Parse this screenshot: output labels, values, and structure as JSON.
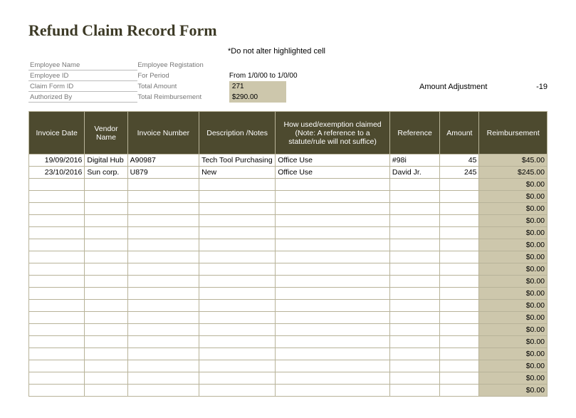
{
  "title": "Refund Claim Record Form",
  "note": "*Do not alter highlighted cell",
  "meta": {
    "labels1": [
      "Employee Name",
      "Employee ID",
      "Claim Form ID",
      "Authorized By"
    ],
    "labels2": [
      "Employee Registation",
      "For Period",
      "Total Amount",
      "Total Reimbursement"
    ],
    "values3": [
      "",
      "From 1/0/00 to 1/0/00",
      "271",
      "$290.00"
    ]
  },
  "adjustment": {
    "label": "Amount Adjustment",
    "value": "-19"
  },
  "headers": [
    "Invoice Date",
    "Vendor Name",
    "Invoice Number",
    "Description /Notes",
    "How used/exemption claimed (Note:  A reference to a statute/rule will not suffice)",
    "Reference",
    "Amount",
    "Reimbursement"
  ],
  "rows": [
    {
      "invdate": "19/09/2016",
      "vendor": "Digital Hub",
      "invnum": "A90987",
      "desc": "Tech Tool Purchasing",
      "how": "Office Use",
      "ref": "#98i",
      "amt": "45",
      "reimb": "$45.00"
    },
    {
      "invdate": "23/10/2016",
      "vendor": "Sun corp.",
      "invnum": "U879",
      "desc": "New",
      "how": "Office Use",
      "ref": "David Jr.",
      "amt": "245",
      "reimb": "$245.00"
    },
    {
      "invdate": "",
      "vendor": "",
      "invnum": "",
      "desc": "",
      "how": "",
      "ref": "",
      "amt": "",
      "reimb": "$0.00"
    },
    {
      "invdate": "",
      "vendor": "",
      "invnum": "",
      "desc": "",
      "how": "",
      "ref": "",
      "amt": "",
      "reimb": "$0.00"
    },
    {
      "invdate": "",
      "vendor": "",
      "invnum": "",
      "desc": "",
      "how": "",
      "ref": "",
      "amt": "",
      "reimb": "$0.00"
    },
    {
      "invdate": "",
      "vendor": "",
      "invnum": "",
      "desc": "",
      "how": "",
      "ref": "",
      "amt": "",
      "reimb": "$0.00"
    },
    {
      "invdate": "",
      "vendor": "",
      "invnum": "",
      "desc": "",
      "how": "",
      "ref": "",
      "amt": "",
      "reimb": "$0.00"
    },
    {
      "invdate": "",
      "vendor": "",
      "invnum": "",
      "desc": "",
      "how": "",
      "ref": "",
      "amt": "",
      "reimb": "$0.00"
    },
    {
      "invdate": "",
      "vendor": "",
      "invnum": "",
      "desc": "",
      "how": "",
      "ref": "",
      "amt": "",
      "reimb": "$0.00"
    },
    {
      "invdate": "",
      "vendor": "",
      "invnum": "",
      "desc": "",
      "how": "",
      "ref": "",
      "amt": "",
      "reimb": "$0.00"
    },
    {
      "invdate": "",
      "vendor": "",
      "invnum": "",
      "desc": "",
      "how": "",
      "ref": "",
      "amt": "",
      "reimb": "$0.00"
    },
    {
      "invdate": "",
      "vendor": "",
      "invnum": "",
      "desc": "",
      "how": "",
      "ref": "",
      "amt": "",
      "reimb": "$0.00"
    },
    {
      "invdate": "",
      "vendor": "",
      "invnum": "",
      "desc": "",
      "how": "",
      "ref": "",
      "amt": "",
      "reimb": "$0.00"
    },
    {
      "invdate": "",
      "vendor": "",
      "invnum": "",
      "desc": "",
      "how": "",
      "ref": "",
      "amt": "",
      "reimb": "$0.00"
    },
    {
      "invdate": "",
      "vendor": "",
      "invnum": "",
      "desc": "",
      "how": "",
      "ref": "",
      "amt": "",
      "reimb": "$0.00"
    },
    {
      "invdate": "",
      "vendor": "",
      "invnum": "",
      "desc": "",
      "how": "",
      "ref": "",
      "amt": "",
      "reimb": "$0.00"
    },
    {
      "invdate": "",
      "vendor": "",
      "invnum": "",
      "desc": "",
      "how": "",
      "ref": "",
      "amt": "",
      "reimb": "$0.00"
    },
    {
      "invdate": "",
      "vendor": "",
      "invnum": "",
      "desc": "",
      "how": "",
      "ref": "",
      "amt": "",
      "reimb": "$0.00"
    },
    {
      "invdate": "",
      "vendor": "",
      "invnum": "",
      "desc": "",
      "how": "",
      "ref": "",
      "amt": "",
      "reimb": "$0.00"
    },
    {
      "invdate": "",
      "vendor": "",
      "invnum": "",
      "desc": "",
      "how": "",
      "ref": "",
      "amt": "",
      "reimb": "$0.00"
    }
  ]
}
